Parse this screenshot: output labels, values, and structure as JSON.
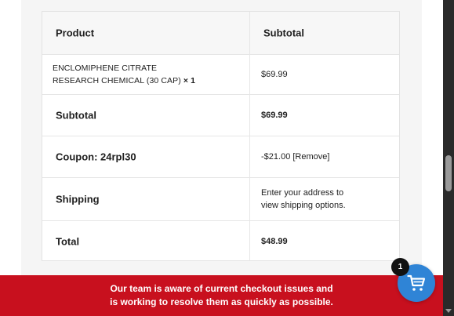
{
  "table": {
    "header": {
      "product": "Product",
      "subtotal": "Subtotal"
    },
    "item": {
      "name_line1": "ENCLOMIPHENE CITRATE",
      "name_line2": "RESEARCH CHEMICAL (30 CAP)",
      "quantity": "× 1",
      "price": "$69.99"
    },
    "subtotal": {
      "label": "Subtotal",
      "value": "$69.99"
    },
    "coupon": {
      "label": "Coupon: 24rpl30",
      "value": "-$21.00",
      "remove_label": "[Remove]"
    },
    "shipping": {
      "label": "Shipping",
      "line1": "Enter your address to",
      "line2": "view shipping options."
    },
    "total": {
      "label": "Total",
      "value": "$48.99"
    }
  },
  "notice": {
    "line1": "Our team is aware of current checkout issues and",
    "line2": "is working to resolve them as quickly as possible.",
    "color": "#c8101e"
  },
  "cart": {
    "icon": "cart-icon",
    "count": "1",
    "color": "#2f84d6"
  }
}
